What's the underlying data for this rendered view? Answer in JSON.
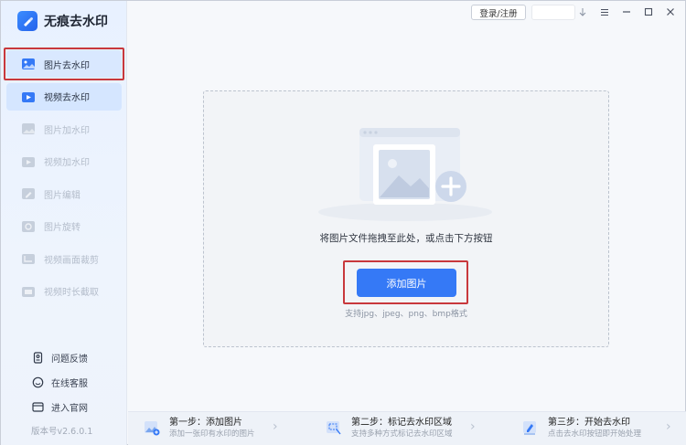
{
  "app": {
    "name": "无痕去水印",
    "version": "版本号v2.6.0.1"
  },
  "titlebar": {
    "login_label": "登录/注册",
    "controls": [
      "pin-icon",
      "menu-icon",
      "minimize-icon",
      "maximize-icon",
      "close-icon"
    ]
  },
  "sidebar": {
    "items": [
      {
        "label": "图片去水印",
        "icon": "image-remove-icon"
      },
      {
        "label": "视频去水印",
        "icon": "video-remove-icon"
      },
      {
        "label": "图片加水印",
        "icon": "image-add-icon"
      },
      {
        "label": "视频加水印",
        "icon": "video-add-icon"
      },
      {
        "label": "图片编辑",
        "icon": "image-edit-icon"
      },
      {
        "label": "图片旋转",
        "icon": "image-rotate-icon"
      },
      {
        "label": "视频画面裁剪",
        "icon": "video-crop-icon"
      },
      {
        "label": "视频时长截取",
        "icon": "video-trim-icon"
      }
    ],
    "bottom_links": [
      {
        "label": "问题反馈",
        "icon": "feedback-icon"
      },
      {
        "label": "在线客服",
        "icon": "support-icon"
      },
      {
        "label": "进入官网",
        "icon": "website-icon"
      }
    ]
  },
  "upload": {
    "drop_text": "将图片文件拖拽至此处，或点击下方按钮",
    "button_label": "添加图片",
    "formats": "支持jpg、jpeg、png、bmp格式"
  },
  "steps": [
    {
      "title": "第一步：添加图片",
      "desc": "添加一张印有水印的图片",
      "icon": "add-image-step-icon"
    },
    {
      "title": "第二步：标记去水印区域",
      "desc": "支持多种方式标记去水印区域",
      "icon": "mark-area-step-icon"
    },
    {
      "title": "第三步：开始去水印",
      "desc": "点击去水印按钮即开始处理",
      "icon": "start-step-icon"
    }
  ],
  "colors": {
    "accent": "#3579f6",
    "highlight_border": "#c8383c",
    "sidebar_bg": "#e8f1ff"
  }
}
